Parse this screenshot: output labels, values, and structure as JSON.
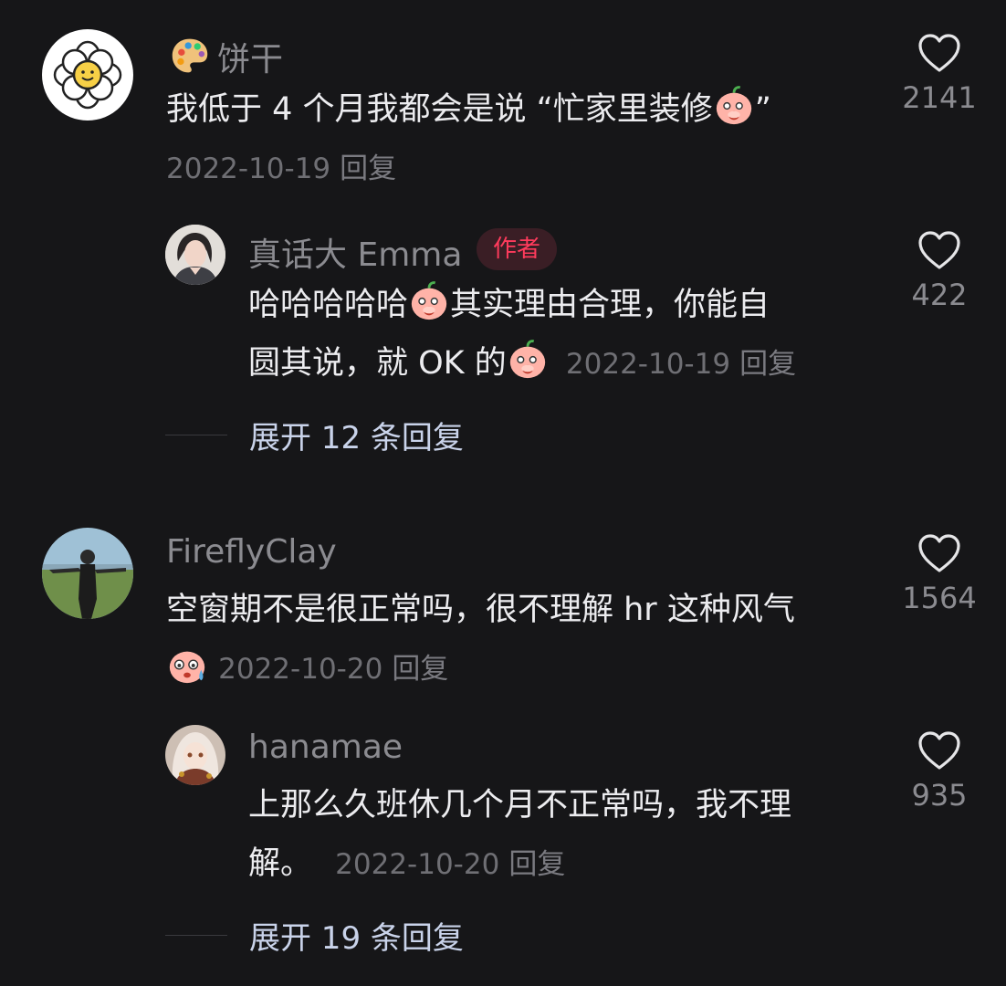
{
  "comments": [
    {
      "username": "饼干",
      "text_a": "我低于 4 个月我都会是说 “忙家里装修",
      "text_b": "”",
      "date": "2022-10-19",
      "reply": "回复",
      "likes": "2141",
      "replies": [
        {
          "username": "真话大 Emma",
          "badge": "作者",
          "text_a": "哈哈哈哈哈",
          "text_b": "其实理由合理，你能自",
          "text_c": "圆其说，就 OK 的",
          "date": "2022-10-19",
          "reply": "回复",
          "likes": "422"
        }
      ],
      "expand": "展开 12 条回复"
    },
    {
      "username": "FireflyClay",
      "text_a": "空窗期不是很正常吗，很不理解 hr 这种风气",
      "date": "2022-10-20",
      "reply": "回复",
      "likes": "1564",
      "replies": [
        {
          "username": "hanamae",
          "text_a": "上那么久班休几个月不正常吗，我不理",
          "text_b": "解。",
          "date": "2022-10-20",
          "reply": "回复",
          "likes": "935"
        }
      ],
      "expand": "展开 19 条回复"
    }
  ],
  "icons": {
    "heart": "heart-outline-icon",
    "palette": "palette-emoji-icon",
    "shy": "shy-face-emoji-icon",
    "sweat": "sweat-face-emoji-icon"
  },
  "colors": {
    "background": "#161618",
    "author_badge": "#ff3b5c",
    "expand_link": "#c9d3ea"
  }
}
